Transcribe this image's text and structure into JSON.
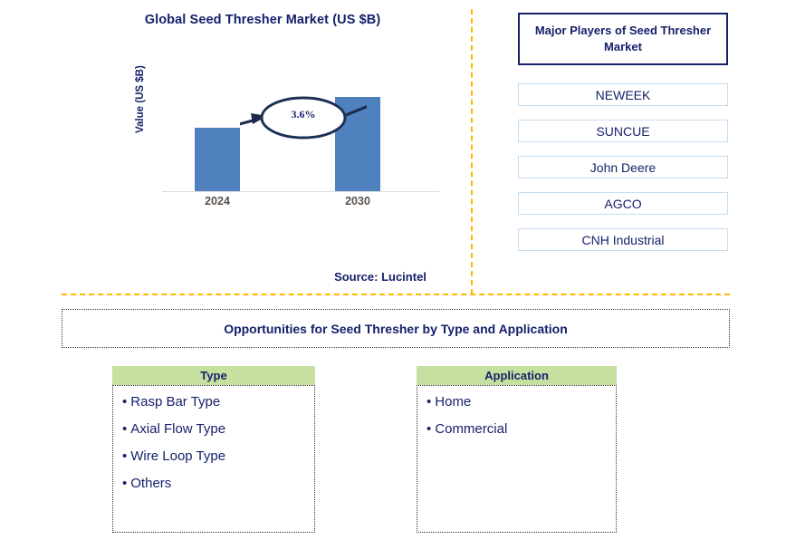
{
  "chart": {
    "title": "Global Seed Thresher Market (US $B)",
    "ylabel": "Value (US $B)",
    "cagr_label": "3.6%",
    "tick_2024": "2024",
    "tick_2030": "2030",
    "bar_color": "#4e81bd",
    "source": "Source: Lucintel"
  },
  "chart_data": {
    "type": "bar",
    "title": "Global Seed Thresher Market (US $B)",
    "xlabel": "",
    "ylabel": "Value (US $B)",
    "categories": [
      "2024",
      "2030"
    ],
    "values": [
      60,
      90
    ],
    "value_unit": "relative bar height (US $B, unlabeled axis)",
    "annotations": [
      {
        "text": "3.6%",
        "kind": "cagr-callout",
        "from": "2024",
        "to": "2030"
      }
    ],
    "grid": false,
    "legend": "none",
    "series": [
      {
        "name": "Value (US $B)",
        "values": [
          60,
          90
        ],
        "color": "#4e81bd"
      }
    ]
  },
  "players": {
    "header": "Major Players of Seed Thresher Market",
    "items": [
      "NEWEEK",
      "SUNCUE",
      "John Deere",
      "AGCO",
      "CNH Industrial"
    ]
  },
  "opportunities": {
    "banner": "Opportunities for Seed Thresher by Type and Application",
    "bullet": "•",
    "columns": [
      {
        "header": "Type",
        "items": [
          "Rasp Bar Type",
          "Axial Flow Type",
          "Wire Loop Type",
          "Others"
        ]
      },
      {
        "header": "Application",
        "items": [
          "Home",
          "Commercial"
        ]
      }
    ]
  },
  "colors": {
    "navy": "#16216b",
    "bar_blue": "#4e81bd",
    "divider_orange": "#ffb600",
    "segment_green": "#c6e0a0",
    "player_border": "#c5dcf0"
  }
}
